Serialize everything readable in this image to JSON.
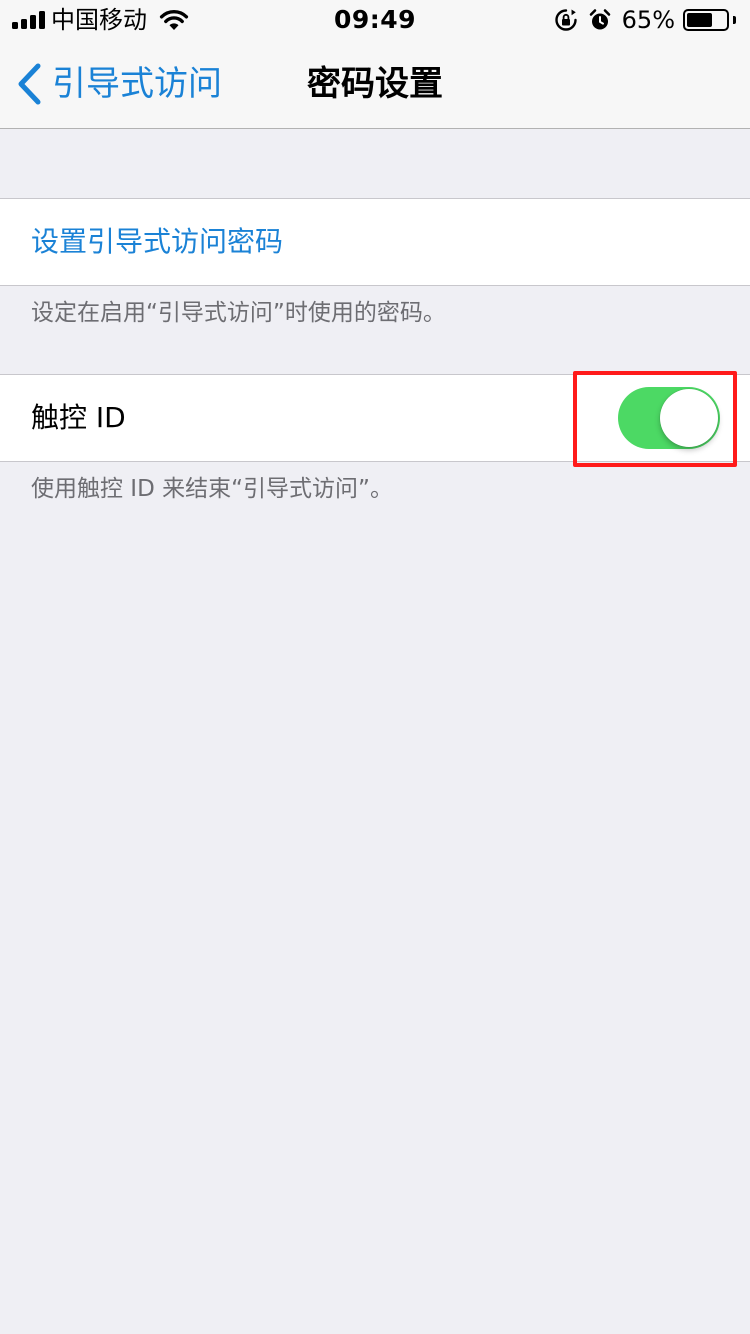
{
  "status_bar": {
    "carrier": "中国移动",
    "time": "09:49",
    "battery_percent": "65%",
    "battery_level": 0.65,
    "icons": [
      "signal-icon",
      "wifi-icon",
      "orientation-lock-icon",
      "alarm-icon",
      "battery-icon"
    ]
  },
  "nav": {
    "back_label": "引导式访问",
    "title": "密码设置"
  },
  "settings": {
    "set_passcode_label": "设置引导式访问密码",
    "set_passcode_note": "设定在启用“引导式访问”时使用的密码。",
    "touch_id_label": "触控 ID",
    "touch_id_enabled": true,
    "touch_id_note": "使用触控 ID 来结束“引导式访问”。"
  },
  "colors": {
    "accent": "#1a82d6",
    "toggle_on": "#4cd964",
    "highlight": "#ff1a1a",
    "background": "#efeff4"
  }
}
